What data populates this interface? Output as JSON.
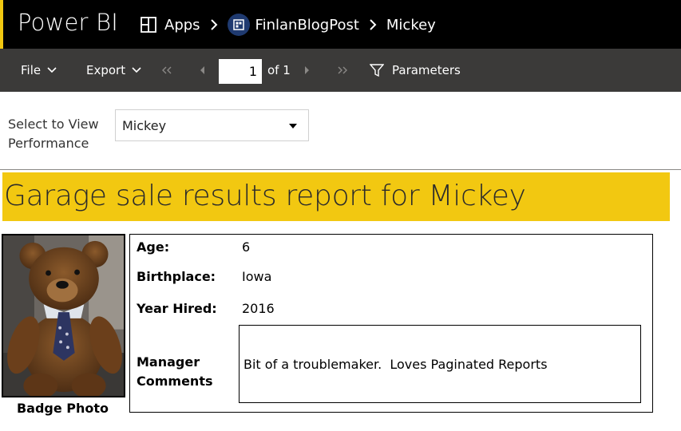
{
  "header": {
    "brand": "Power BI",
    "breadcrumbs": {
      "apps": "Apps",
      "workspace": "FinlanBlogPost",
      "report": "Mickey"
    },
    "accent_color": "#f2c811"
  },
  "toolbar": {
    "file_label": "File",
    "export_label": "Export",
    "current_page": "1",
    "page_of": "of 1",
    "parameters_label": "Parameters"
  },
  "parameters": {
    "label": "Select to View Performance",
    "selected": "Mickey"
  },
  "report": {
    "title": "Garage sale results report for Mickey",
    "banner_color": "#f2c811",
    "photo_caption": "Badge Photo",
    "fields": {
      "age_label": "Age:",
      "age_value": "6",
      "birthplace_label": "Birthplace:",
      "birthplace_value": "Iowa",
      "year_hired_label": "Year Hired:",
      "year_hired_value": "2016",
      "comments_label_1": "Manager",
      "comments_label_2": "Comments",
      "comments_value": "Bit of a troublemaker.  Loves Paginated Reports"
    }
  }
}
